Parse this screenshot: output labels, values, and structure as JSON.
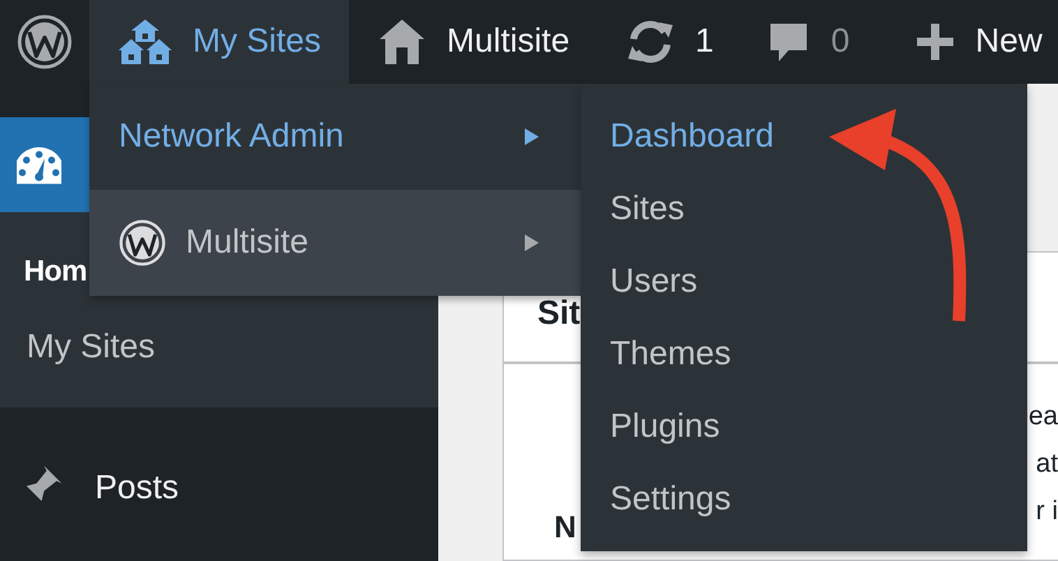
{
  "admin_bar": {
    "items": [
      {
        "kind": "logo",
        "selected": false
      },
      {
        "kind": "sites",
        "label": "My Sites",
        "selected": true
      },
      {
        "kind": "home",
        "label": "Multisite",
        "selected": false
      },
      {
        "kind": "updates",
        "label": "1",
        "selected": false
      },
      {
        "kind": "comments",
        "label": "0",
        "selected": false
      },
      {
        "kind": "new",
        "label": "New",
        "selected": false
      }
    ]
  },
  "sidebar": {
    "items": [
      {
        "kind": "dashboard",
        "selected": true,
        "submenu": [
          {
            "label": "Hom",
            "selected": true
          },
          {
            "label": "My Sites",
            "selected": false
          }
        ]
      },
      {
        "kind": "posts",
        "label": "Posts",
        "selected": false
      }
    ]
  },
  "content": {
    "card": {
      "title": "Sit",
      "right_fragments": [
        "ea",
        "at",
        "r i"
      ],
      "left_fragments": [
        "N"
      ]
    }
  },
  "sites_menu": {
    "items": [
      {
        "kind": "network",
        "label": "Network Admin",
        "selected": true,
        "hovered": false
      },
      {
        "kind": "site",
        "label": "Multisite",
        "selected": false,
        "hovered": true
      }
    ]
  },
  "network_admin_menu": {
    "items": [
      {
        "label": "Dashboard",
        "selected": true
      },
      {
        "label": "Sites",
        "selected": false
      },
      {
        "label": "Users",
        "selected": false
      },
      {
        "label": "Themes",
        "selected": false
      },
      {
        "label": "Plugins",
        "selected": false
      },
      {
        "label": "Settings",
        "selected": false
      }
    ]
  },
  "annotations": [
    {
      "kind": "arrow"
    }
  ]
}
